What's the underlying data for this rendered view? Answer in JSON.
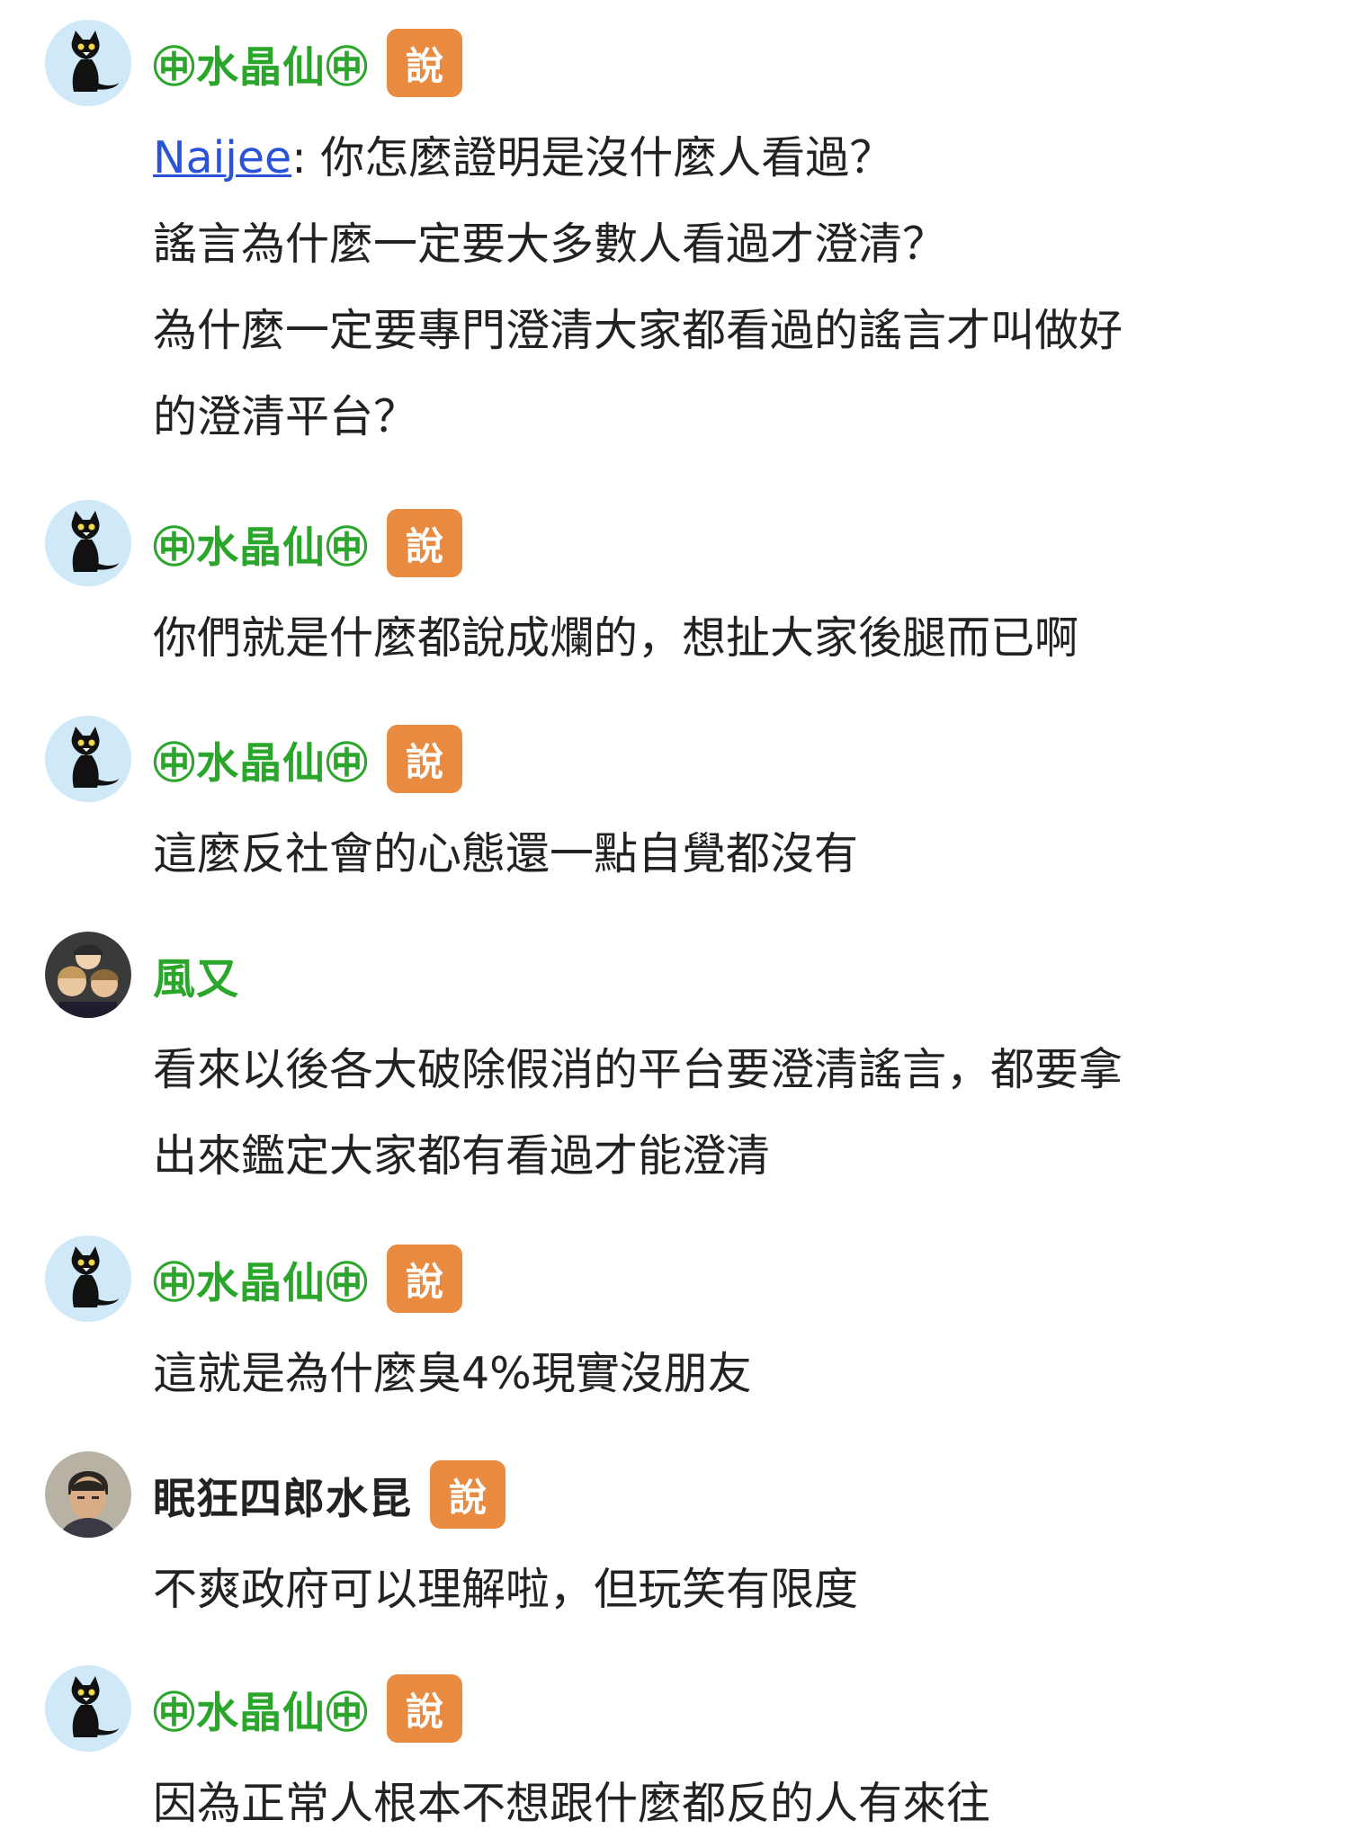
{
  "say_label": "說",
  "comments": [
    {
      "user": "㊥水晶仙㊥",
      "avatar_icon": "black-cat-avatar",
      "mention": "Naijee",
      "lines": [
        ": 你怎麼證明是沒什麼人看過？",
        "謠言為什麼一定要大多數人看過才澄清？",
        "為什麼一定要專門澄清大家都看過的謠言才叫做好",
        "的澄清平台？"
      ]
    },
    {
      "user": "㊥水晶仙㊥",
      "avatar_icon": "black-cat-avatar",
      "lines": [
        "你們就是什麼都說成爛的，想扯大家後腿而已啊"
      ]
    },
    {
      "user": "㊥水晶仙㊥",
      "avatar_icon": "black-cat-avatar",
      "lines": [
        "這麼反社會的心態還一點自覺都沒有"
      ]
    },
    {
      "user": "風又",
      "avatar_icon": "anime-group-avatar",
      "lines": [
        "看來以後各大破除假消的平台要澄清謠言，都要拿",
        "出來鑑定大家都有看過才能澄清"
      ]
    },
    {
      "user": "㊥水晶仙㊥",
      "avatar_icon": "black-cat-avatar",
      "lines": [
        "這就是為什麼臭4%現實沒朋友"
      ]
    },
    {
      "user": "眠狂四郎水昆",
      "avatar_icon": "samurai-portrait-avatar",
      "lines": [
        "不爽政府可以理解啦，但玩笑有限度"
      ]
    },
    {
      "user": "㊥水晶仙㊥",
      "avatar_icon": "black-cat-avatar",
      "lines": [
        "因為正常人根本不想跟什麼都反的人有來往"
      ]
    }
  ],
  "colors": {
    "username_green": "#2aa62a",
    "badge_orange": "#e88a40",
    "mention_blue": "#2b53d9",
    "avatar_bg": "#cfe9f9"
  }
}
